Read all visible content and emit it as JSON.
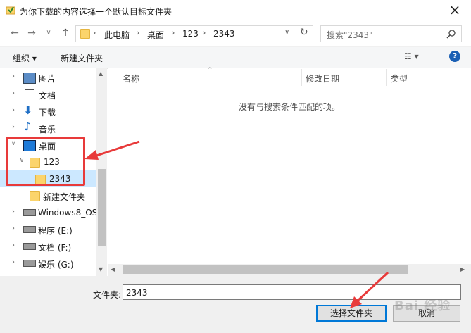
{
  "window": {
    "title": "为你下载的内容选择一个默认目标文件夹",
    "close_label": "×"
  },
  "nav": {
    "back_label": "←",
    "forward_label": "→",
    "dropdown_label": "∨",
    "up_label": "↑",
    "breadcrumb": [
      "此电脑",
      "桌面",
      "123",
      "2343"
    ],
    "refresh_label": "↻",
    "search_placeholder": "搜索\"2343\""
  },
  "toolbar": {
    "organize_label": "组织 ▾",
    "new_folder_label": "新建文件夹",
    "view_label": "☷ ▾",
    "help_label": "?"
  },
  "tree": {
    "items": [
      {
        "label": "图片"
      },
      {
        "label": "文档"
      },
      {
        "label": "下载"
      },
      {
        "label": "音乐"
      },
      {
        "label": "桌面"
      },
      {
        "label": "123"
      },
      {
        "label": "2343"
      },
      {
        "label": "新建文件夹"
      },
      {
        "label": "Windows8_OS"
      },
      {
        "label": "程序 (E:)"
      },
      {
        "label": "文档 (F:)"
      },
      {
        "label": "娱乐 (G:)"
      }
    ]
  },
  "columns": [
    "名称",
    "修改日期",
    "类型"
  ],
  "empty_message": "没有与搜索条件匹配的项。",
  "footer": {
    "folder_label": "文件夹:",
    "folder_value": "2343",
    "select_button": "选择文件夹",
    "cancel_button": "取消"
  },
  "watermark": "Bai 经验",
  "colors": {
    "accent": "#0078d7",
    "selected_bg": "#cce8ff",
    "annotation_red": "#e83a3a",
    "folder_yellow": "#fbd46c"
  }
}
